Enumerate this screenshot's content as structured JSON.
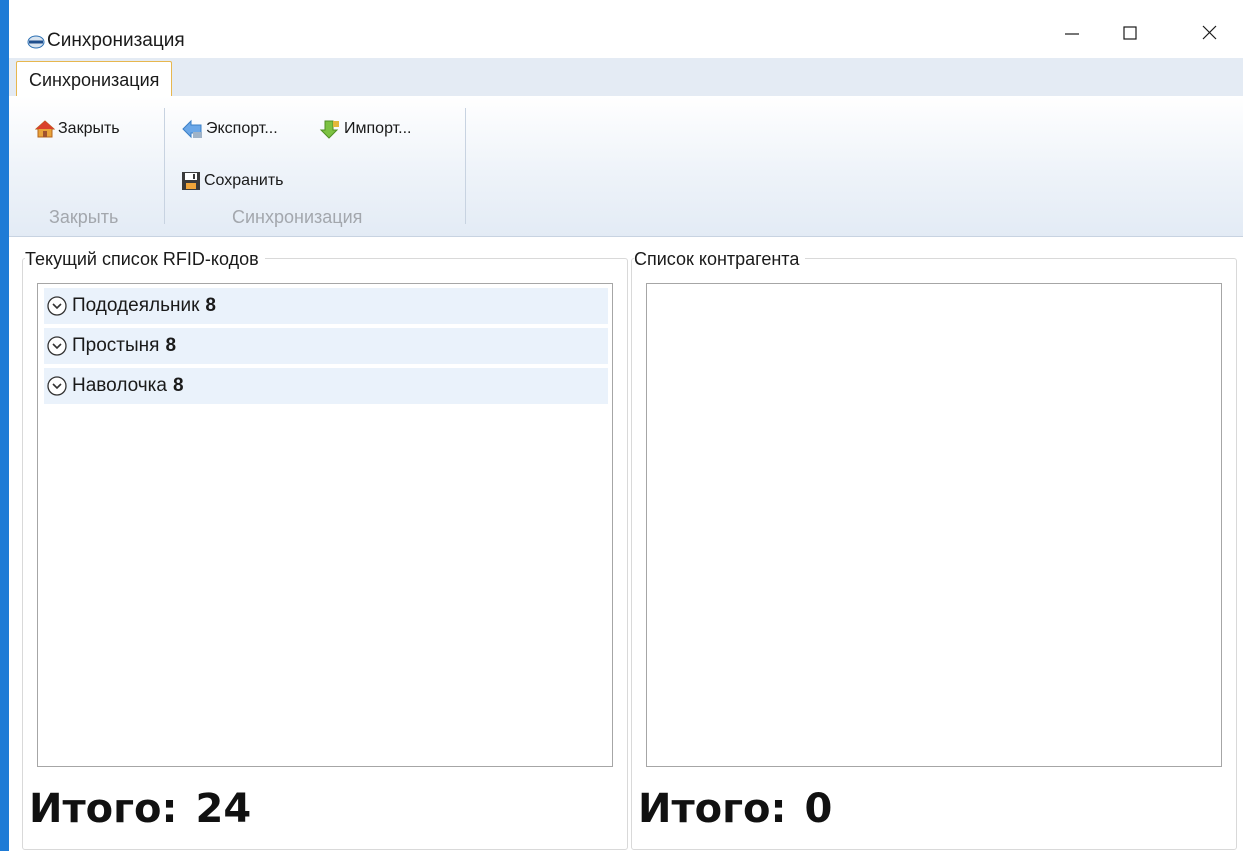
{
  "window": {
    "title": "Синхронизация",
    "controls": [
      "minimize",
      "maximize",
      "close"
    ]
  },
  "ribbon": {
    "tabs": [
      {
        "label": "Синхронизация",
        "active": true
      }
    ],
    "groups": [
      {
        "label": "Закрыть",
        "buttons": [
          {
            "label": "Закрыть",
            "icon": "home-icon"
          }
        ]
      },
      {
        "label": "Синхронизация",
        "buttons": [
          {
            "label": "Экспорт...",
            "icon": "export-arrow-icon"
          },
          {
            "label": "Импорт...",
            "icon": "import-arrow-icon"
          },
          {
            "label": "Сохранить",
            "icon": "save-icon"
          }
        ]
      }
    ]
  },
  "left_panel": {
    "title": "Текущий список RFID-кодов",
    "items": [
      {
        "name": "Пододеяльник",
        "count": "8"
      },
      {
        "name": "Простыня",
        "count": "8"
      },
      {
        "name": "Наволочка",
        "count": "8"
      }
    ],
    "total_label": "Итого:",
    "total_value": "24"
  },
  "right_panel": {
    "title": "Список контрагента",
    "items": [],
    "total_label": "Итого:",
    "total_value": "0"
  },
  "colors": {
    "accent": "#1e7bd6",
    "ribbon_tab_border": "#e7b74f",
    "list_item_bg": "#eaf2fb"
  }
}
